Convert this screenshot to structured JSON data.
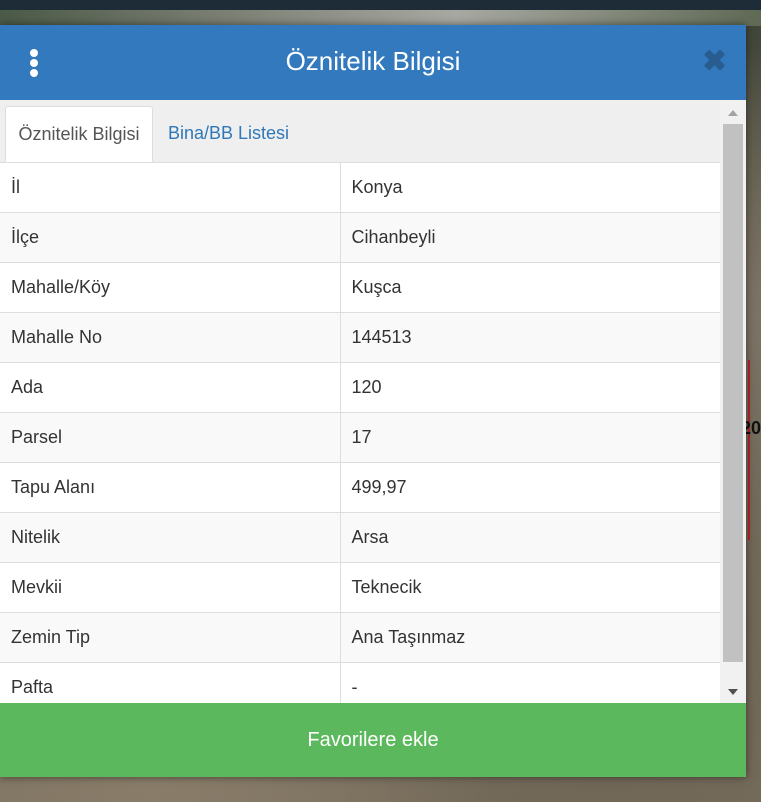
{
  "dialog": {
    "title": "Öznitelik Bilgisi",
    "close_icon": "close-icon",
    "menu_icon": "vertical-dots-icon"
  },
  "tabs": [
    {
      "label": "Öznitelik Bilgisi",
      "active": true
    },
    {
      "label": "Bina/BB Listesi",
      "active": false
    }
  ],
  "attributes": [
    {
      "key": "İl",
      "value": "Konya"
    },
    {
      "key": "İlçe",
      "value": "Cihanbeyli"
    },
    {
      "key": "Mahalle/Köy",
      "value": "Kuşca"
    },
    {
      "key": "Mahalle No",
      "value": "144513"
    },
    {
      "key": "Ada",
      "value": "120"
    },
    {
      "key": "Parsel",
      "value": "17"
    },
    {
      "key": "Tapu Alanı",
      "value": "499,97"
    },
    {
      "key": "Nitelik",
      "value": "Arsa"
    },
    {
      "key": "Mevkii",
      "value": "Teknecik"
    },
    {
      "key": "Zemin Tip",
      "value": "Ana Taşınmaz"
    },
    {
      "key": "Pafta",
      "value": "-"
    }
  ],
  "footer": {
    "favorite_label": "Favorilere ekle"
  },
  "map": {
    "partial_label": "20"
  },
  "colors": {
    "header": "#3279be",
    "favorite_button": "#5cb85c",
    "tab_link": "#2f78b8"
  }
}
